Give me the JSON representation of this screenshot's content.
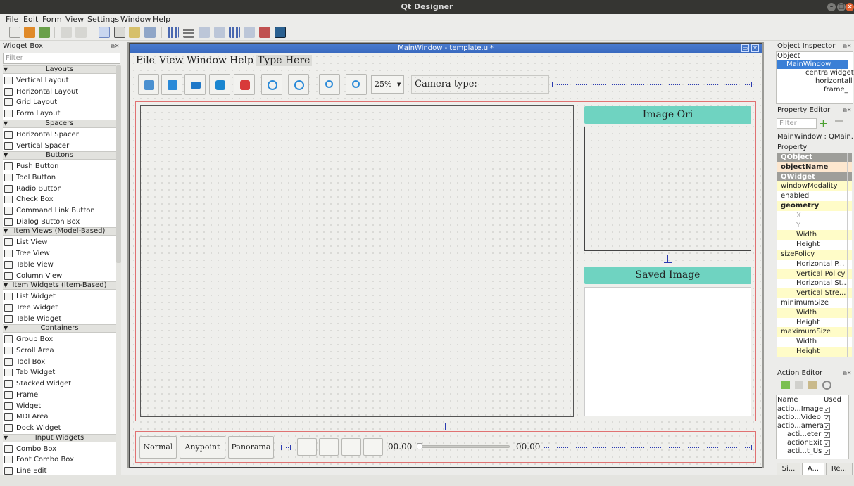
{
  "app_title": "Qt Designer",
  "menubar": [
    "File",
    "Edit",
    "Form",
    "View",
    "Settings",
    "Window",
    "Help"
  ],
  "widget_box": {
    "title": "Widget Box",
    "filter_placeholder": "Filter",
    "categories": [
      {
        "label": "Layouts",
        "items": [
          "Vertical Layout",
          "Horizontal Layout",
          "Grid Layout",
          "Form Layout"
        ]
      },
      {
        "label": "Spacers",
        "items": [
          "Horizontal Spacer",
          "Vertical Spacer"
        ]
      },
      {
        "label": "Buttons",
        "items": [
          "Push Button",
          "Tool Button",
          "Radio Button",
          "Check Box",
          "Command Link Button",
          "Dialog Button Box"
        ]
      },
      {
        "label": "Item Views (Model-Based)",
        "items": [
          "List View",
          "Tree View",
          "Table View",
          "Column View"
        ]
      },
      {
        "label": "Item Widgets (Item-Based)",
        "items": [
          "List Widget",
          "Tree Widget",
          "Table Widget"
        ]
      },
      {
        "label": "Containers",
        "items": [
          "Group Box",
          "Scroll Area",
          "Tool Box",
          "Tab Widget",
          "Stacked Widget",
          "Frame",
          "Widget",
          "MDI Area",
          "Dock Widget"
        ]
      },
      {
        "label": "Input Widgets",
        "items": [
          "Combo Box",
          "Font Combo Box",
          "Line Edit"
        ]
      }
    ]
  },
  "form_window": {
    "title": "MainWindow - template.ui*",
    "menu": [
      "File",
      "View",
      "Window",
      "Help",
      "Type Here"
    ],
    "zoom": "25%",
    "camera_label": "Camera type:",
    "image_ori_label": "Image Ori",
    "saved_image_label": "Saved Image",
    "mode_buttons": [
      "Normal",
      "Anypoint",
      "Panorama"
    ],
    "time_start": "00.00",
    "time_end": "00.00",
    "slider_value": 0
  },
  "object_inspector": {
    "title": "Object Inspector",
    "column": "Object",
    "tree": [
      "MainWindow",
      "centralwidget",
      "horizontall",
      "frame_"
    ]
  },
  "property_editor": {
    "title": "Property Editor",
    "filter_placeholder": "Filter",
    "context": "MainWindow : QMain...",
    "column": "Property",
    "rows": [
      {
        "label": "QObject",
        "type": "grp"
      },
      {
        "label": "objectName",
        "type": "o"
      },
      {
        "label": "QWidget",
        "type": "grp"
      },
      {
        "label": "windowModality",
        "type": "y"
      },
      {
        "label": "enabled",
        "type": "w"
      },
      {
        "label": "geometry",
        "type": "y"
      },
      {
        "label": "X",
        "type": "w"
      },
      {
        "label": "Y",
        "type": "w"
      },
      {
        "label": "Width",
        "type": "y"
      },
      {
        "label": "Height",
        "type": "w"
      },
      {
        "label": "sizePolicy",
        "type": "y"
      },
      {
        "label": "Horizontal P...",
        "type": "w"
      },
      {
        "label": "Vertical Policy",
        "type": "y"
      },
      {
        "label": "Horizontal St...",
        "type": "w"
      },
      {
        "label": "Vertical Stre...",
        "type": "y"
      },
      {
        "label": "minimumSize",
        "type": "w"
      },
      {
        "label": "Width",
        "type": "y"
      },
      {
        "label": "Height",
        "type": "w"
      },
      {
        "label": "maximumSize",
        "type": "y"
      },
      {
        "label": "Width",
        "type": "w"
      },
      {
        "label": "Height",
        "type": "y"
      }
    ]
  },
  "action_editor": {
    "title": "Action Editor",
    "columns": [
      "Name",
      "Used"
    ],
    "actions": [
      "actio...Image",
      "actio...Video",
      "actio...amera",
      "acti...eter",
      "actionExit",
      "acti...t_Us"
    ]
  },
  "bottom_tabs": [
    "Si...",
    "A...",
    "Re..."
  ]
}
